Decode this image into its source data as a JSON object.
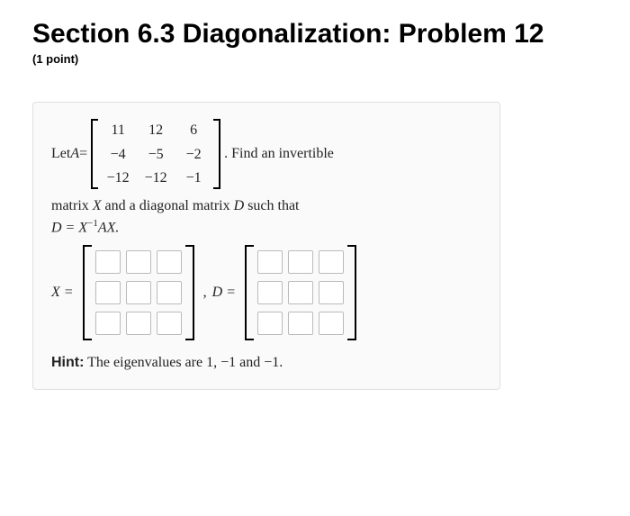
{
  "title": "Section 6.3 Diagonalization: Problem 12",
  "points": "(1 point)",
  "problem": {
    "let_text": "Let ",
    "A_sym": "A",
    "eq": " = ",
    "matrixA": {
      "r1": [
        "11",
        "12",
        "6"
      ],
      "r2": [
        "−4",
        "−5",
        "−2"
      ],
      "r3_partial": [
        "−12",
        "−12",
        "−1"
      ]
    },
    "find_text": ". Find an invertible",
    "statement_line1": "matrix ",
    "X_sym": "X",
    "statement_mid": " and a diagonal matrix ",
    "D_sym": "D",
    "statement_end": " such that",
    "eq_line": "D = X",
    "inv_exp": "−1",
    "eq_line2": "AX.",
    "Xeq": "X = ",
    "comma": " , ",
    "Deq": "D = ",
    "hint_label": "Hint:",
    "hint_text": " The eigenvalues are 1, −1 and −1."
  }
}
